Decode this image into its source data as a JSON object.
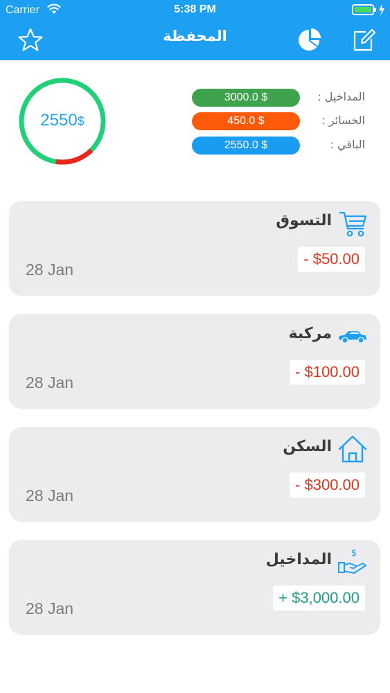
{
  "status_bar": {
    "carrier": "Carrier",
    "time": "5:38 PM"
  },
  "nav": {
    "title": "المحفظة",
    "left_icon": "star-icon",
    "right_icons": [
      "pie-chart-icon",
      "edit-icon"
    ]
  },
  "summary": {
    "ring_value": "2550",
    "ring_currency": "$",
    "spent_fraction": 0.15,
    "rows": [
      {
        "label": "المداخيل :",
        "value": "3000.0 $",
        "color": "#3fa34d"
      },
      {
        "label": "الخسائر :",
        "value": "450.0 $",
        "color": "#ff5a0a"
      },
      {
        "label": "الباقي :",
        "value": "2550.0 $",
        "color": "#1a9cf2"
      }
    ]
  },
  "colors": {
    "accent": "#1d9ff2",
    "ring_main": "#22d07a",
    "ring_spent": "#e8281c"
  },
  "transactions": [
    {
      "title": "التسوق",
      "amount": "- $50.00",
      "type": "expense",
      "date": "28 Jan",
      "icon": "shopping-cart-icon"
    },
    {
      "title": "مركبة",
      "amount": "- $100.00",
      "type": "expense",
      "date": "28 Jan",
      "icon": "car-icon"
    },
    {
      "title": "السكن",
      "amount": "- $300.00",
      "type": "expense",
      "date": "28 Jan",
      "icon": "house-icon"
    },
    {
      "title": "المداخيل",
      "amount": "+ $3,000.00",
      "type": "income",
      "date": "28 Jan",
      "icon": "money-hand-icon"
    }
  ]
}
